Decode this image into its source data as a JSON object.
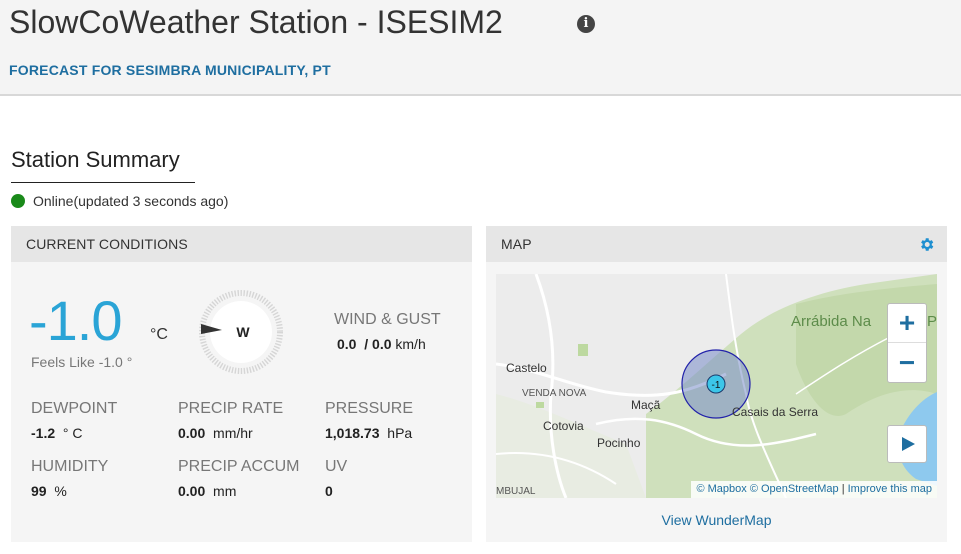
{
  "header": {
    "title": "SlowCoWeather Station - ISESIM2",
    "info_icon": "i",
    "subtitle": "FORECAST FOR SESIMBRA MUNICIPALITY, PT"
  },
  "summary": {
    "title": "Station Summary",
    "status_text": "Online(updated 3 seconds ago)",
    "status_color": "#1a8a1a"
  },
  "current": {
    "heading": "CURRENT CONDITIONS",
    "temperature": "-1.0",
    "temperature_unit": "°C",
    "feels_like": "Feels Like -1.0 °",
    "wind_direction": "W",
    "wind_label": "WIND & GUST",
    "wind_value": "0.0",
    "gust_value": "/ 0.0",
    "wind_unit": "km/h",
    "dewpoint_label": "DEWPOINT",
    "dewpoint_value": "-1.2",
    "dewpoint_unit": "° C",
    "precip_rate_label": "PRECIP RATE",
    "precip_rate_value": "0.00",
    "precip_rate_unit": "mm/hr",
    "pressure_label": "PRESSURE",
    "pressure_value": "1,018.73",
    "pressure_unit": "hPa",
    "humidity_label": "HUMIDITY",
    "humidity_value": "99",
    "humidity_unit": "%",
    "precip_accum_label": "PRECIP ACCUM",
    "precip_accum_value": "0.00",
    "precip_accum_unit": "mm",
    "uv_label": "UV",
    "uv_value": "0"
  },
  "map": {
    "heading": "MAP",
    "zoom_in": "+",
    "zoom_out": "−",
    "marker_label": "-1",
    "places": {
      "arrabida": "Arrábida Na",
      "arrabida_cut": "P",
      "castelo": "Castelo",
      "venda_nova": "VENDA NOVA",
      "maca": "Maçã",
      "cotovia": "Cotovia",
      "casais": "Casais da Serra",
      "pocinho": "Pocinho",
      "mbujal": "MBUJAL"
    },
    "attribution": {
      "mapbox": "© Mapbox",
      "osm": "© OpenStreetMap",
      "separator": "|",
      "improve": "Improve this map"
    },
    "view_link": "View WunderMap"
  },
  "colors": {
    "accent": "#1e6ea0",
    "temperature": "#2aa4d6",
    "online": "#1a8a1a"
  },
  "icons": [
    "info-icon",
    "gear-icon",
    "compass-icon",
    "play-icon",
    "zoom-in-icon",
    "zoom-out-icon",
    "status-dot-icon"
  ]
}
